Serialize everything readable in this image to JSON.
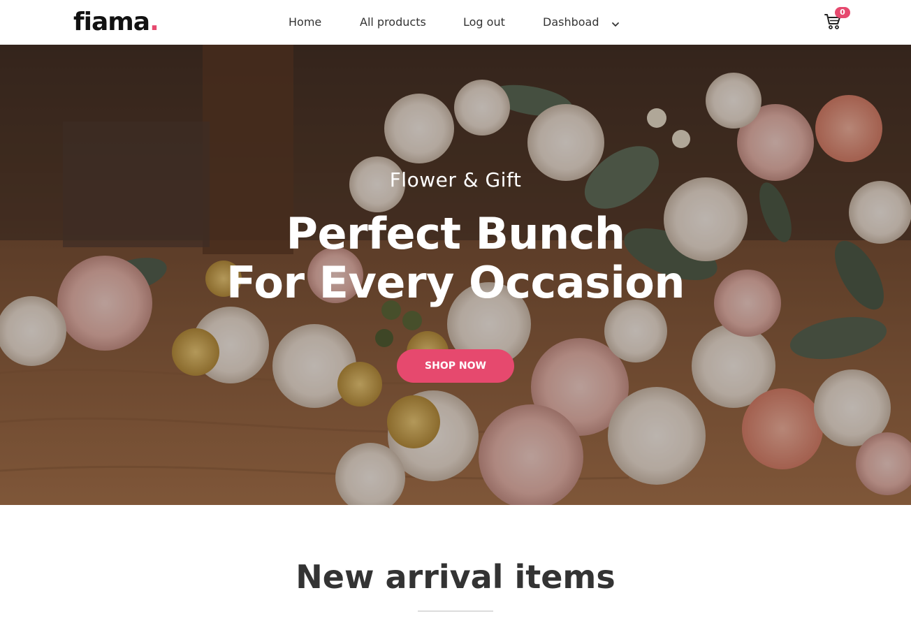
{
  "header": {
    "logo_text": "fiama",
    "logo_dot": ".",
    "nav": [
      {
        "label": "Home"
      },
      {
        "label": "All products"
      },
      {
        "label": "Log out"
      },
      {
        "label": "Dashboad"
      }
    ],
    "cart_count": "0",
    "icons": {
      "dropdown": "chevron-down-icon",
      "cart": "cart-icon"
    }
  },
  "hero": {
    "subtitle": "Flower & Gift",
    "title_line1": "Perfect Bunch",
    "title_line2": "For Every Occasion",
    "button_label": "SHOP NOW"
  },
  "section": {
    "title": "New arrival items"
  },
  "colors": {
    "accent": "#e6496e",
    "text_dark": "#333333",
    "logo": "#111111"
  }
}
